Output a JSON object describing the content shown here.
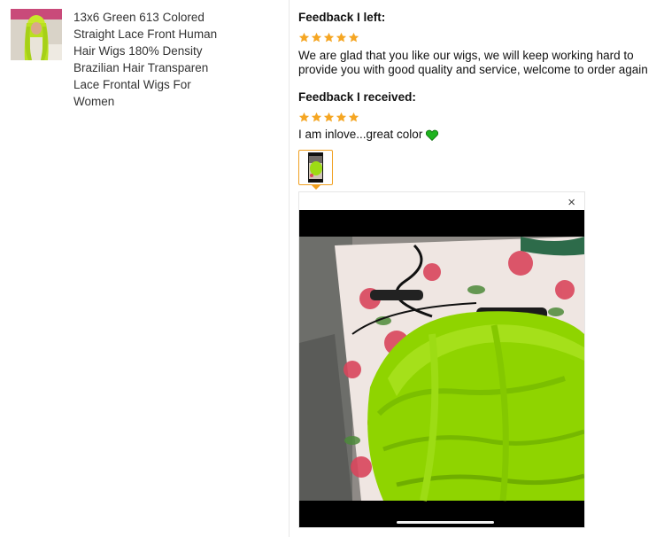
{
  "product": {
    "title": "13x6 Green 613 Colored Straight Lace Front Human Hair Wigs 180% Density Brazilian Hair Transparen Lace Frontal Wigs For Women",
    "thumbnail_icon": "wig-product-photo"
  },
  "feedback_left": {
    "heading": "Feedback I left:",
    "rating": 5,
    "text": "We are glad that you like our wigs, we will keep working hard to provide you with good quality and service, welcome to order again"
  },
  "feedback_received": {
    "heading": "Feedback I received:",
    "rating": 5,
    "text": "I am inlove...great color",
    "emoji": "green-heart-icon"
  },
  "viewer": {
    "close_label": "×"
  },
  "colors": {
    "star": "#f5a623",
    "thumb_border": "#f0a020",
    "heart": "#1fb31f",
    "wig_green": "#8fd400"
  }
}
